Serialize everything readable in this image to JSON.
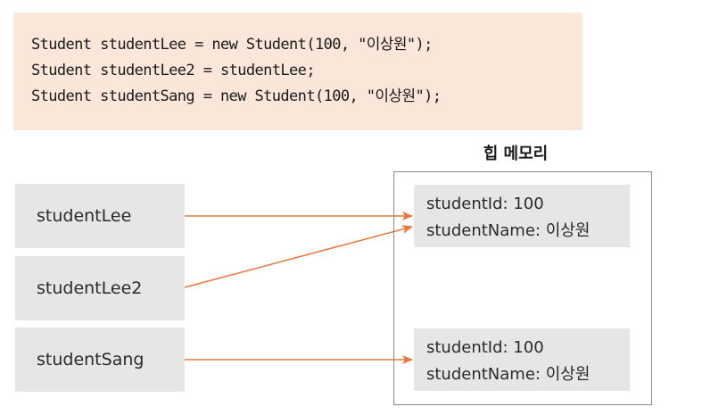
{
  "code": {
    "lines": [
      "Student studentLee = new Student(100, \"이상원\");",
      "Student studentLee2 = studentLee;",
      "Student studentSang = new Student(100, \"이상원\");"
    ]
  },
  "heap": {
    "title": "힙 메모리"
  },
  "variables": [
    {
      "label": "studentLee"
    },
    {
      "label": "studentLee2"
    },
    {
      "label": "studentSang"
    }
  ],
  "objects": [
    {
      "id_line": "studentId: 100",
      "name_line": "studentName: 이상원"
    },
    {
      "id_line": "studentId: 100",
      "name_line": "studentName: 이상원"
    }
  ],
  "colors": {
    "code_background": "#fbe7d9",
    "box_fill": "#e6e6e7",
    "arrow": "#e8773a",
    "heap_border": "#8a8a8a"
  }
}
